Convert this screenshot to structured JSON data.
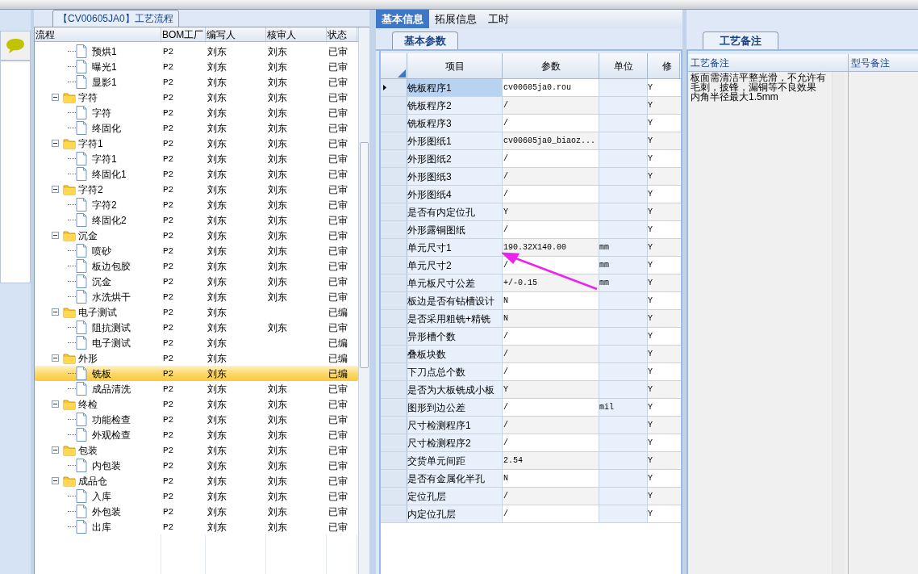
{
  "flow_panel": {
    "title": "【CV00605JA0】工艺流程",
    "columns": [
      "流程",
      "BOM工厂",
      "编写人",
      "核审人",
      "状态"
    ],
    "tree": [
      {
        "children": [
          {
            "name": "预烘1",
            "bom": "P2",
            "writer": "刘东",
            "reviewer": "刘东",
            "status": "已审",
            "selected": false
          },
          {
            "name": "曝光1",
            "bom": "P2",
            "writer": "刘东",
            "reviewer": "刘东",
            "status": "已审",
            "selected": false
          },
          {
            "name": "显影1",
            "bom": "P2",
            "writer": "刘东",
            "reviewer": "刘东",
            "status": "已审",
            "selected": false
          }
        ]
      },
      {
        "name": "字符",
        "bom": "P2",
        "writer": "刘东",
        "reviewer": "刘东",
        "status": "已审",
        "selected": false,
        "expanded": true,
        "children": [
          {
            "name": "字符",
            "bom": "P2",
            "writer": "刘东",
            "reviewer": "刘东",
            "status": "已审",
            "selected": false
          },
          {
            "name": "终固化",
            "bom": "P2",
            "writer": "刘东",
            "reviewer": "刘东",
            "status": "已审",
            "selected": false
          }
        ]
      },
      {
        "name": "字符1",
        "bom": "P2",
        "writer": "刘东",
        "reviewer": "刘东",
        "status": "已审",
        "selected": false,
        "expanded": true,
        "children": [
          {
            "name": "字符1",
            "bom": "P2",
            "writer": "刘东",
            "reviewer": "刘东",
            "status": "已审",
            "selected": false
          },
          {
            "name": "终固化1",
            "bom": "P2",
            "writer": "刘东",
            "reviewer": "刘东",
            "status": "已审",
            "selected": false
          }
        ]
      },
      {
        "name": "字符2",
        "bom": "P2",
        "writer": "刘东",
        "reviewer": "刘东",
        "status": "已审",
        "selected": false,
        "expanded": true,
        "children": [
          {
            "name": "字符2",
            "bom": "P2",
            "writer": "刘东",
            "reviewer": "刘东",
            "status": "已审",
            "selected": false
          },
          {
            "name": "终固化2",
            "bom": "P2",
            "writer": "刘东",
            "reviewer": "刘东",
            "status": "已审",
            "selected": false
          }
        ]
      },
      {
        "name": "沉金",
        "bom": "P2",
        "writer": "刘东",
        "reviewer": "刘东",
        "status": "已审",
        "selected": false,
        "expanded": true,
        "children": [
          {
            "name": "喷砂",
            "bom": "P2",
            "writer": "刘东",
            "reviewer": "刘东",
            "status": "已审",
            "selected": false
          },
          {
            "name": "板边包胶",
            "bom": "P2",
            "writer": "刘东",
            "reviewer": "刘东",
            "status": "已审",
            "selected": false
          },
          {
            "name": "沉金",
            "bom": "P2",
            "writer": "刘东",
            "reviewer": "刘东",
            "status": "已审",
            "selected": false
          },
          {
            "name": "水洗烘干",
            "bom": "P2",
            "writer": "刘东",
            "reviewer": "刘东",
            "status": "已审",
            "selected": false
          }
        ]
      },
      {
        "name": "电子测试",
        "bom": "P2",
        "writer": "刘东",
        "status": "已编",
        "selected": false,
        "expanded": true,
        "children": [
          {
            "name": "阻抗测试",
            "bom": "P2",
            "writer": "刘东",
            "reviewer": "刘东",
            "status": "已审",
            "selected": false
          },
          {
            "name": "电子测试",
            "bom": "P2",
            "writer": "刘东",
            "status": "已编",
            "selected": false
          }
        ]
      },
      {
        "name": "外形",
        "bom": "P2",
        "writer": "刘东",
        "status": "已编",
        "selected": false,
        "expanded": true,
        "children": [
          {
            "name": "铣板",
            "bom": "P2",
            "writer": "刘东",
            "status": "已编",
            "selected": true
          },
          {
            "name": "成品清洗",
            "bom": "P2",
            "writer": "刘东",
            "reviewer": "刘东",
            "status": "已审",
            "selected": false
          }
        ]
      },
      {
        "name": "终检",
        "bom": "P2",
        "writer": "刘东",
        "reviewer": "刘东",
        "status": "已审",
        "selected": false,
        "expanded": true,
        "children": [
          {
            "name": "功能检查",
            "bom": "P2",
            "writer": "刘东",
            "reviewer": "刘东",
            "status": "已审",
            "selected": false
          },
          {
            "name": "外观检查",
            "bom": "P2",
            "writer": "刘东",
            "reviewer": "刘东",
            "status": "已审",
            "selected": false
          }
        ]
      },
      {
        "name": "包装",
        "bom": "P2",
        "writer": "刘东",
        "reviewer": "刘东",
        "status": "已审",
        "selected": false,
        "expanded": true,
        "children": [
          {
            "name": "内包装",
            "bom": "P2",
            "writer": "刘东",
            "reviewer": "刘东",
            "status": "已审",
            "selected": false
          }
        ]
      },
      {
        "name": "成品仓",
        "bom": "P2",
        "writer": "刘东",
        "reviewer": "刘东",
        "status": "已审",
        "selected": false,
        "expanded": true,
        "children": [
          {
            "name": "入库",
            "bom": "P2",
            "writer": "刘东",
            "reviewer": "刘东",
            "status": "已审",
            "selected": false
          },
          {
            "name": "外包装",
            "bom": "P2",
            "writer": "刘东",
            "reviewer": "刘东",
            "status": "已审",
            "selected": false
          },
          {
            "name": "出库",
            "bom": "P2",
            "writer": "刘东",
            "reviewer": "刘东",
            "status": "已审",
            "selected": false
          }
        ]
      }
    ]
  },
  "tabs": [
    {
      "label": "基本信息",
      "selected": true
    },
    {
      "label": "拓展信息",
      "selected": false
    },
    {
      "label": "工时",
      "selected": false
    }
  ],
  "params_panel": {
    "subtab": "基本参数",
    "columns": [
      "项目",
      "参数",
      "单位",
      "修"
    ],
    "rows": [
      {
        "item": "铣板程序1",
        "value": "cv00605ja0.rou",
        "modify": "Y",
        "selected": true
      },
      {
        "item": "铣板程序2",
        "value": "/",
        "modify": "Y",
        "selected": false
      },
      {
        "item": "铣板程序3",
        "value": "/",
        "modify": "Y",
        "selected": false
      },
      {
        "item": "外形图纸1",
        "value": "cv00605ja0_biaoz...",
        "modify": "Y",
        "selected": false
      },
      {
        "item": "外形图纸2",
        "value": "/",
        "modify": "Y",
        "selected": false
      },
      {
        "item": "外形图纸3",
        "value": "/",
        "modify": "Y",
        "selected": false
      },
      {
        "item": "外形图纸4",
        "value": "/",
        "modify": "Y",
        "selected": false
      },
      {
        "item": "是否有内定位孔",
        "value": "Y",
        "modify": "Y",
        "selected": false
      },
      {
        "item": "外形露铜图纸",
        "value": "/",
        "modify": "Y",
        "selected": false
      },
      {
        "item": "单元尺寸1",
        "value": "190.32X140.00",
        "unit": "mm",
        "modify": "Y",
        "selected": false
      },
      {
        "item": "单元尺寸2",
        "value": "/",
        "unit": "mm",
        "modify": "Y",
        "selected": false
      },
      {
        "item": "单元板尺寸公差",
        "value": "+/-0.15",
        "unit": "mm",
        "modify": "Y",
        "selected": false
      },
      {
        "item": "板边是否有钻槽设计",
        "value": "N",
        "modify": "Y",
        "selected": false
      },
      {
        "item": "是否采用粗铣+精铣",
        "value": "N",
        "modify": "Y",
        "selected": false
      },
      {
        "item": "异形槽个数",
        "value": "/",
        "modify": "Y",
        "selected": false
      },
      {
        "item": "叠板块数",
        "value": "/",
        "modify": "Y",
        "selected": false
      },
      {
        "item": "下刀点总个数",
        "value": "/",
        "modify": "Y",
        "selected": false
      },
      {
        "item": "是否为大板铣成小板",
        "value": "Y",
        "modify": "Y",
        "selected": false
      },
      {
        "item": "图形到边公差",
        "value": "/",
        "unit": "mil",
        "modify": "Y",
        "selected": false
      },
      {
        "item": "尺寸检测程序1",
        "value": "/",
        "modify": "Y",
        "selected": false
      },
      {
        "item": "尺寸检测程序2",
        "value": "/",
        "modify": "Y",
        "selected": false
      },
      {
        "item": "交货单元间距",
        "value": "2.54",
        "modify": "Y",
        "selected": false
      },
      {
        "item": "是否有金属化半孔",
        "value": "N",
        "modify": "Y",
        "selected": false
      },
      {
        "item": "定位孔层",
        "value": "/",
        "modify": "Y",
        "selected": false
      },
      {
        "item": "内定位孔层",
        "value": "/",
        "modify": "Y",
        "selected": false
      }
    ]
  },
  "notes_panel": {
    "subtab": "工艺备注",
    "columns": [
      "工艺备注",
      "型号备注"
    ],
    "process_note": [
      "板面需清洁平整光滑，不允许有毛刺，披锋，漏铜等不良效果",
      "内角半径最大1.5mm"
    ]
  }
}
